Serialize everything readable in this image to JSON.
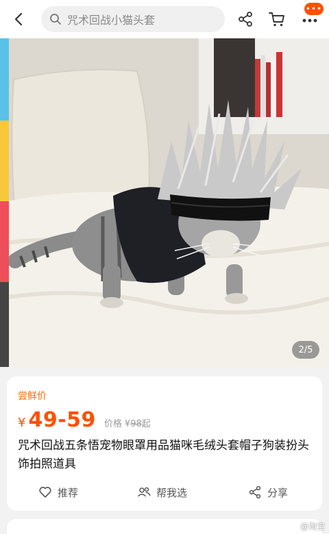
{
  "search": {
    "placeholder": "咒术回战小猫头套"
  },
  "header": {
    "badge": "•••"
  },
  "gallery": {
    "counter": "2/5",
    "strip_colors": [
      "#59c2e6",
      "#f8c73a",
      "#ee4e5a",
      "#444444"
    ]
  },
  "product": {
    "promo_label": "尝鲜价",
    "currency": "¥",
    "price": "49-59",
    "orig_label": "价格",
    "orig_currency": "¥",
    "orig_price": "98",
    "orig_suffix": "起",
    "title": "咒术回战五条悟宠物眼罩用品猫咪毛绒头套帽子狗装扮头饰拍照道具"
  },
  "actions": {
    "recommend": "推荐",
    "help_choose": "帮我选",
    "share": "分享"
  },
  "watermark": "@淘宝",
  "colors": {
    "accent": "#ff5000",
    "promo": "#ff6a00"
  }
}
